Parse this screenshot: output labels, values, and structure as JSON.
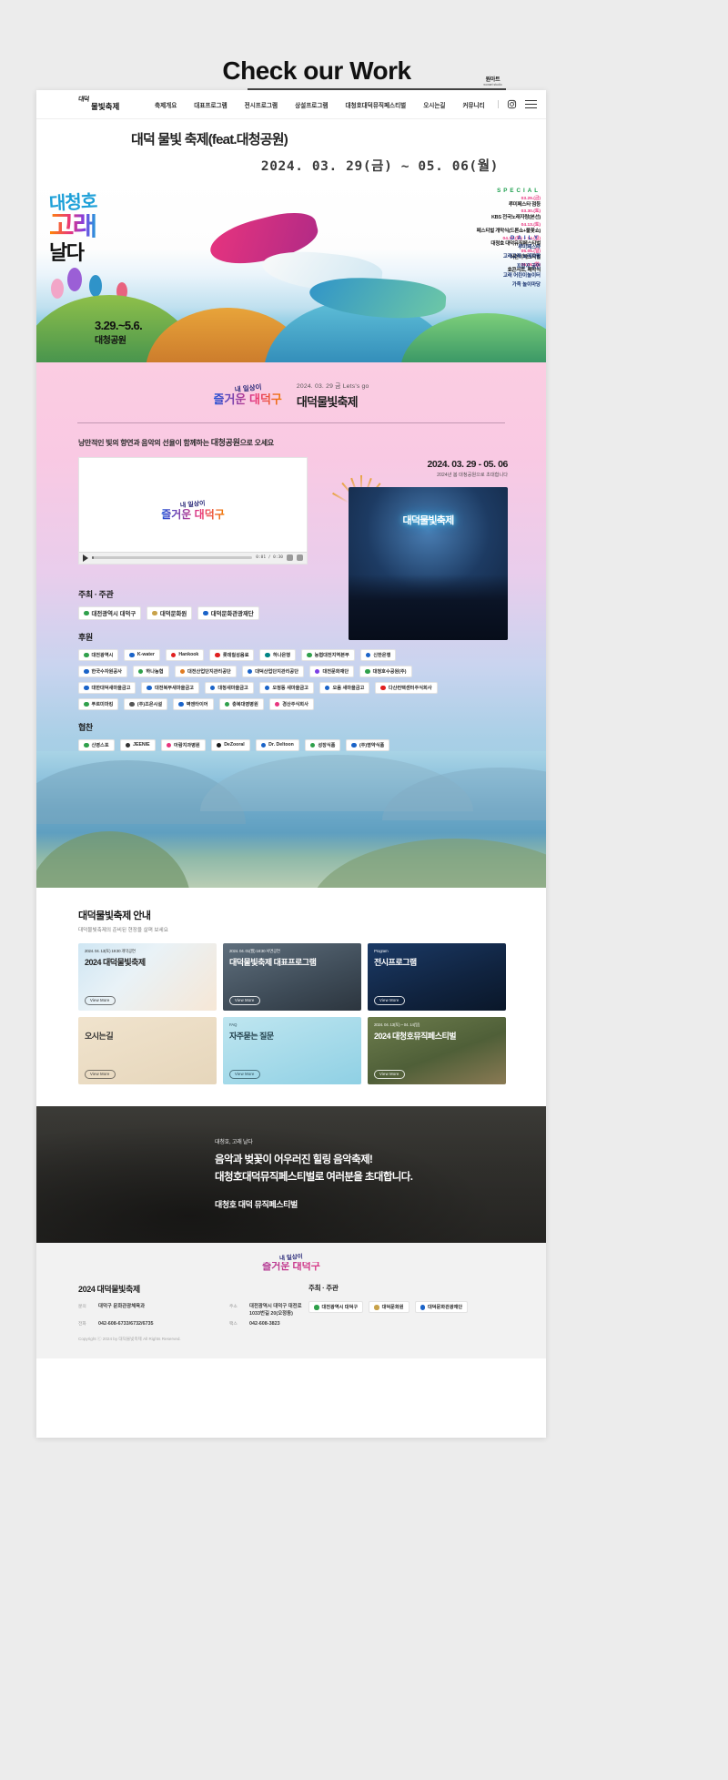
{
  "top": {
    "title": "Check our Work",
    "badge_line1": "원아트",
    "badge_line2": "wonart studio"
  },
  "nav": {
    "logo_top": "대덕",
    "logo_main": "물빛축제",
    "items": [
      "축제개요",
      "대표프로그램",
      "전시프로그램",
      "상설프로그램",
      "대청호대덕뮤직페스티벌",
      "오시는길",
      "커뮤니티"
    ],
    "instagram_icon": "instagram-icon",
    "menu_icon": "hamburger-menu-icon"
  },
  "hero": {
    "title": "대덕 물빛 축제(feat.대청공원)",
    "date_range": "2024. 03. 29(금) ~ 05. 06(월)"
  },
  "poster": {
    "big_line1": "대청호",
    "big_line2": "고래",
    "big_line3": "날다",
    "when_line1": "3.29.~5.6.",
    "when_line2": "대청공원",
    "special_heading": "SPECIAL",
    "special_items": [
      {
        "date": "03.29.(금)",
        "title": "루미페스타 점등"
      },
      {
        "date": "03.30.(토)",
        "title": "KBS 전국노래자랑(본선)"
      },
      {
        "date": "04.13.(토)",
        "title": "페스티벌 개막식(드론쇼+불꽃쇼)"
      },
      {
        "date": "04.13.(토) ~ 14.(일)",
        "title": "대청호 대덕뮤직페스티벌"
      },
      {
        "date": "05.05.(일)",
        "title": "어린이페스티벌"
      },
      {
        "date": "05.06.(월)",
        "title": "효콘서트, 폐막식"
      }
    ],
    "daily_heading": "DAILY",
    "daily_items": [
      "루미페스타",
      "고래고래 노래자랑",
      "프린지 공연",
      "고래 어린이놀이터",
      "가족 놀이마당"
    ]
  },
  "pink": {
    "brand_top": "내 일상이",
    "brand_main": "즐거운 대덕구",
    "eyebrow": "2024. 03. 29 금 Lets's go",
    "heading": "대덕물빛축제",
    "lead_prefix": "낭만적인 빛의 향연과 음악의 선율이 함께하는 ",
    "lead_strong": "대청공원",
    "lead_suffix": "으로 오세요",
    "video": {
      "logo_top": "내 일상이",
      "logo_main": "즐거운 대덕구",
      "time": "0:01 / 0:30"
    },
    "promo_date": "2024. 03. 29 - 05. 06",
    "promo_sub": "2024년 봄 대청공원으로 초대합니다",
    "promo_image_caption": "대덕물빛축제"
  },
  "sponsors": {
    "host_heading": "주최 · 주관",
    "host": [
      {
        "name": "대전광역시 대덕구",
        "color": "#2fa04b"
      },
      {
        "name": "대덕문화원",
        "color": "#c8a24a"
      },
      {
        "name": "대덕문화관광재단",
        "color": "#1a63c8"
      }
    ],
    "support_heading": "후원",
    "support": [
      {
        "name": "대전광역시",
        "color": "#2fa04b"
      },
      {
        "name": "K-water",
        "color": "#1a63c8"
      },
      {
        "name": "Hankook",
        "color": "#e02020"
      },
      {
        "name": "롯데칠성음료",
        "color": "#e02020"
      },
      {
        "name": "하나은행",
        "color": "#008485"
      },
      {
        "name": "농협대전지역본부",
        "color": "#2fa04b"
      },
      {
        "name": "신한은행",
        "color": "#1a63c8"
      },
      {
        "name": "한국수자원공사",
        "color": "#1a63c8"
      },
      {
        "name": "하나농협",
        "color": "#2fa04b"
      },
      {
        "name": "대전산업단지관리공단",
        "color": "#e07b20"
      },
      {
        "name": "대덕산업단지관리공단",
        "color": "#1a63c8"
      },
      {
        "name": "대전문화재단",
        "color": "#7b3fe4"
      },
      {
        "name": "대청호수공원(주)",
        "color": "#2fa04b"
      },
      {
        "name": "대한대덕새마을금고",
        "color": "#1a63c8"
      },
      {
        "name": "대전북부새마을금고",
        "color": "#1a63c8"
      },
      {
        "name": "대청새마을금고",
        "color": "#1a63c8"
      },
      {
        "name": "오정동 새마을금고",
        "color": "#1a63c8"
      },
      {
        "name": "오음 새마을금고",
        "color": "#1a63c8"
      },
      {
        "name": "다산컨택센터주식회사",
        "color": "#e02020"
      },
      {
        "name": "푸르미마킹",
        "color": "#2fa04b"
      },
      {
        "name": "(주)조은시설",
        "color": "#555555"
      },
      {
        "name": "벽앤타이어",
        "color": "#1a63c8"
      },
      {
        "name": "충북대영병원",
        "color": "#2fa04b"
      },
      {
        "name": "경산주식회사",
        "color": "#e8347e"
      }
    ],
    "partner_heading": "협찬",
    "partners": [
      {
        "name": "신영스포",
        "color": "#2fa04b"
      },
      {
        "name": "JEENIE",
        "color": "#333333"
      },
      {
        "name": "아람지과병원",
        "color": "#e8347e"
      },
      {
        "name": "DeZooral",
        "color": "#1a1a1a"
      },
      {
        "name": "Dr. Deltoon",
        "color": "#1a63c8"
      },
      {
        "name": "성장식품",
        "color": "#2fa04b"
      },
      {
        "name": "(주)명약식품",
        "color": "#1a63c8"
      }
    ]
  },
  "guide": {
    "heading": "대덕물빛축제 안내",
    "sub": "대덕물빛축제의 준비된 현장을 살펴 보세요",
    "more_label": "View More",
    "cards": [
      {
        "eyebrow": "2024. 04. 13(토) 19:30 개막공연",
        "title": "2024 대덕물빛축제"
      },
      {
        "eyebrow": "2024. 04. 01(월) 18:30 서면공연",
        "title": "대덕물빛축제\n대표프로그램"
      },
      {
        "eyebrow": "Program",
        "title": "전시프로그램"
      },
      {
        "eyebrow": "",
        "title": "오시는길"
      },
      {
        "eyebrow": "FAQ",
        "title": "자주묻는 질문"
      },
      {
        "eyebrow": "2024. 04. 13(토) ~ 04. 14(일)",
        "title": "2024 대청호뮤직페스티벌"
      }
    ]
  },
  "music": {
    "eyebrow": "대청호, 고래 날다",
    "line1": "음악과 벚꽃이 어우러진 힐링 음악축제!",
    "line2": "대청호대덕뮤직페스티벌로 여러분을 초대합니다.",
    "line3": "대청호 대덕 뮤직페스티벌"
  },
  "footer": {
    "brand_top": "내 일상이",
    "brand_main": "즐거운 대덕구",
    "title": "2024 대덕물빛축제",
    "rows": [
      {
        "k1": "문의",
        "v1": "대덕구 문화관광체육과",
        "k2": "주소",
        "v2": "대전광역시 대덕구 대전로 1033번길 20(오정동)"
      },
      {
        "k1": "전화",
        "v1": "042-608-6733/6732/6735",
        "k2": "팩스",
        "v2": "042-608-3823"
      }
    ],
    "copyright": "Copyright ⓒ 2024 by 대덕물빛축제 All Rights Reserved.",
    "host_heading": "주최 · 주관",
    "host_chips": [
      {
        "name": "대전광역시 대덕구",
        "color": "#2fa04b"
      },
      {
        "name": "대덕문화원",
        "color": "#c8a24a"
      },
      {
        "name": "대덕문화관광재단",
        "color": "#1a63c8"
      }
    ]
  },
  "colors": {
    "page_bg": "#ececec",
    "accent_pink": "#f9c9e3",
    "accent_green": "#1a9e4b",
    "accent_blue": "#1b3fa0",
    "magenta": "#e8347e"
  }
}
